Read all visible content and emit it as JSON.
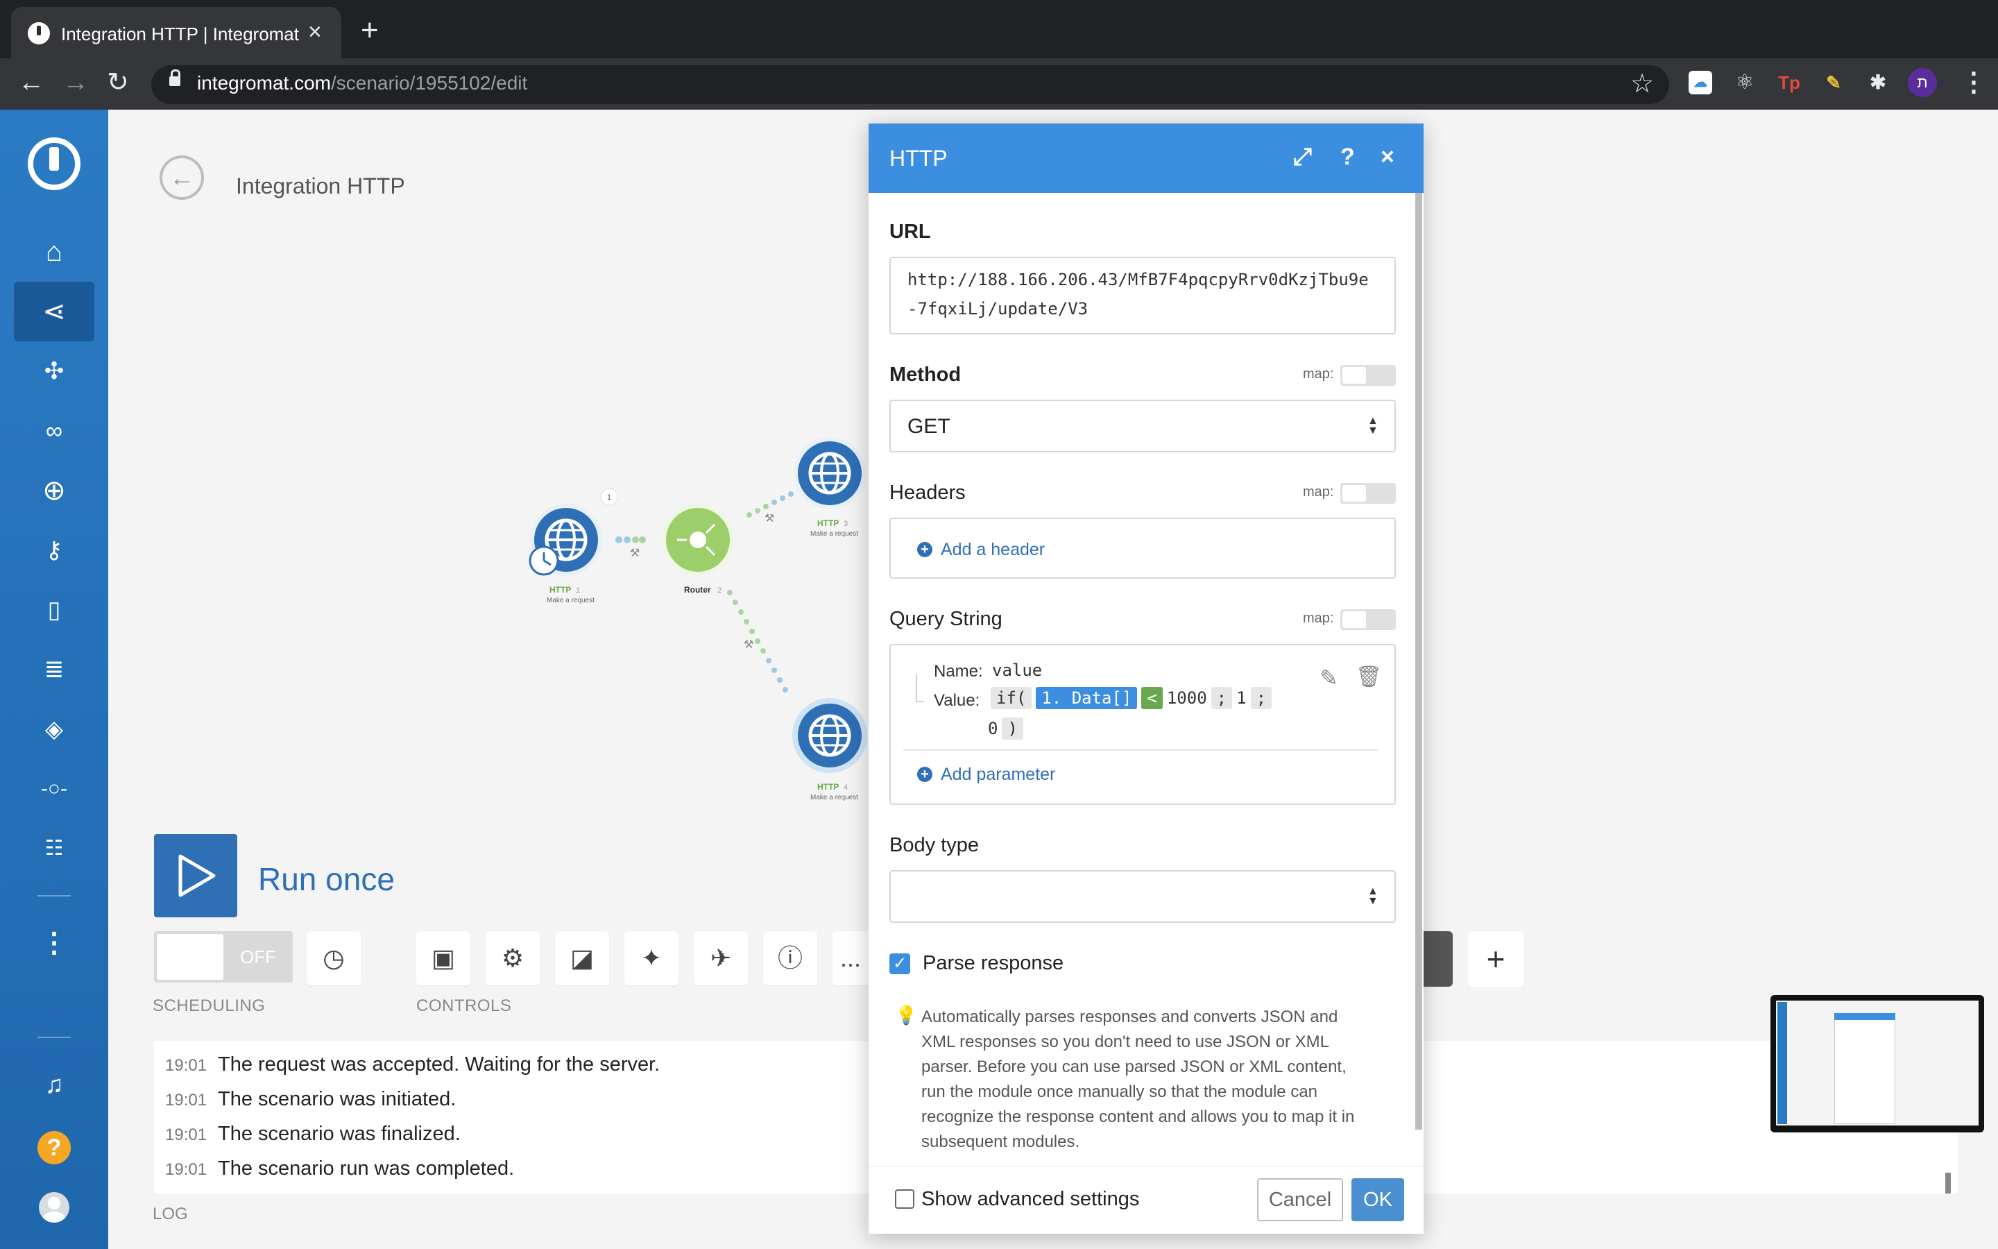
{
  "browser": {
    "tab_title": "Integration HTTP | Integromat",
    "url_host": "integromat.com",
    "url_path": "/scenario/1955102/edit",
    "profile_initial": "ת"
  },
  "scenario": {
    "title": "Integration HTTP",
    "nodes": [
      {
        "label": "HTTP",
        "sub": "Make a request",
        "badge": "1"
      },
      {
        "label": "Router",
        "badge": "2"
      },
      {
        "label": "HTTP",
        "sub": "Make a request",
        "badge": "3"
      },
      {
        "label": "HTTP",
        "sub": "Make a request",
        "badge": "4"
      }
    ],
    "bubble_count": "1"
  },
  "controls": {
    "run_label": "Run once",
    "toggle_state": "OFF",
    "scheduling_caption": "SCHEDULING",
    "controls_caption": "CONTROLS",
    "more_label": "..."
  },
  "log": {
    "caption": "LOG",
    "entries": [
      {
        "time": "19:01",
        "message": "The request was accepted. Waiting for the server."
      },
      {
        "time": "19:01",
        "message": "The scenario was initiated."
      },
      {
        "time": "19:01",
        "message": "The scenario was finalized."
      },
      {
        "time": "19:01",
        "message": "The scenario run was completed."
      }
    ]
  },
  "modal": {
    "title": "HTTP",
    "url_label": "URL",
    "url_value_line1": "http://188.166.206.43/MfB7F4pqcpyRrv0dKzjTbu9e",
    "url_value_line2": "-7fqxiLj/update/V3",
    "method_label": "Method",
    "method_value": "GET",
    "map_label": "map:",
    "headers_label": "Headers",
    "add_header": "Add a header",
    "query_label": "Query String",
    "qs_name_key": "Name:",
    "qs_name_value": "value",
    "qs_value_key": "Value:",
    "qs_tokens": [
      "if(",
      "1. Data[]",
      "<",
      "1000",
      ";",
      "1",
      ";",
      "0",
      ")"
    ],
    "add_parameter": "Add parameter",
    "body_type_label": "Body type",
    "body_type_value": "",
    "parse_response_label": "Parse response",
    "parse_response_checked": true,
    "hint_lines": [
      "Automatically parses responses and converts JSON and",
      "XML responses so you don't need to use JSON or XML",
      "parser. Before you can use parsed JSON or XML content,",
      "run the module once manually so that the module can",
      "recognize the response content and allows you to map it in",
      "subsequent modules."
    ],
    "advanced_label": "Show advanced settings",
    "cancel_label": "Cancel",
    "ok_label": "OK"
  },
  "colors": {
    "primary": "#3b8ee0",
    "sidebar": "#2b7bc4",
    "router": "#9ccf6a",
    "ok_button": "#4a8fd0"
  }
}
